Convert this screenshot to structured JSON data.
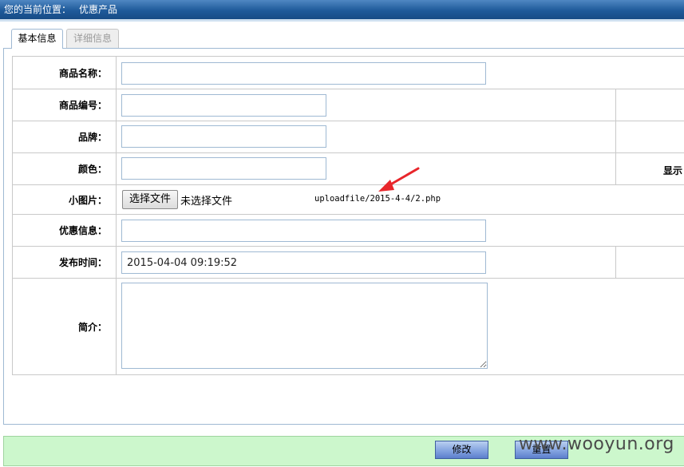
{
  "breadcrumb": {
    "prefix": "您的当前位置：",
    "current": "优惠产品"
  },
  "tabs": [
    {
      "label": "基本信息"
    },
    {
      "label": "详细信息"
    }
  ],
  "form": {
    "name_label": "商品名称：",
    "code_label": "商品编号：",
    "brand_label": "品牌：",
    "color_label": "颜色：",
    "display_label": "显示",
    "image_label": "小图片：",
    "file_button": "选择文件",
    "file_status": "未选择文件",
    "image_path": "uploadfile/2015-4-4/2.php",
    "promo_label": "优惠信息：",
    "time_label": "发布时间：",
    "time_value": "2015-04-04 09:19:52",
    "intro_label": "简介："
  },
  "actions": {
    "modify": "修改",
    "reset": "重置"
  },
  "watermark": "www.wooyun.org",
  "colors": {
    "header": "#1f5a9a",
    "action_bar": "#ccf7cc",
    "arrow": "#e8262b",
    "button": "#7f9fde"
  }
}
